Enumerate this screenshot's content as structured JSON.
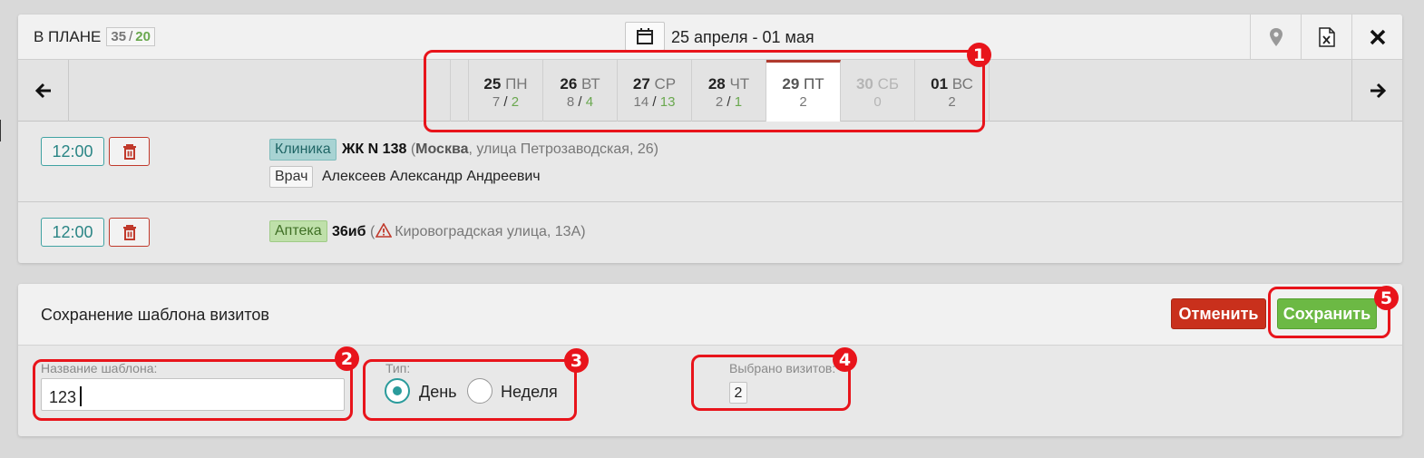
{
  "header": {
    "plan_label": "В ПЛАНЕ",
    "plan_a": "35",
    "plan_sep": "/",
    "plan_b": "20",
    "date_range": "25 апреля - 01 мая",
    "icons": [
      "calendar-icon",
      "map-pin-icon",
      "excel-icon",
      "close-icon"
    ]
  },
  "nav": {
    "prev_icon": "arrow-left-icon",
    "next_icon": "arrow-right-icon"
  },
  "days": [
    {
      "num": "25",
      "wd": "ПН",
      "a": "7",
      "b": "2",
      "state": "normal"
    },
    {
      "num": "26",
      "wd": "ВТ",
      "a": "8",
      "b": "4",
      "state": "normal"
    },
    {
      "num": "27",
      "wd": "СР",
      "a": "14",
      "b": "13",
      "state": "normal"
    },
    {
      "num": "28",
      "wd": "ЧТ",
      "a": "2",
      "b": "1",
      "state": "normal"
    },
    {
      "num": "29",
      "wd": "ПТ",
      "a": "2",
      "b": "",
      "state": "active"
    },
    {
      "num": "30",
      "wd": "СБ",
      "a": "0",
      "b": "",
      "state": "dim"
    },
    {
      "num": "01",
      "wd": "ВС",
      "a": "2",
      "b": "",
      "state": "normal"
    }
  ],
  "visits": [
    {
      "time": "12:00",
      "type": "Клиника",
      "name": "ЖК N 138",
      "addr_open": "(",
      "city": "Москва",
      "address": ", улица Петрозаводская, 26)",
      "role": "Врач",
      "person": "Алексеев Александр Андреевич"
    },
    {
      "time": "12:00",
      "type": "Аптека",
      "name": "36иб",
      "addr_open": "(",
      "address": "Кировоградская улица, 13А)"
    }
  ],
  "template_form": {
    "title": "Сохранение шаблона визитов",
    "cancel_label": "Отменить",
    "save_label": "Сохранить",
    "name_label": "Название шаблона:",
    "name_value": "123",
    "type_label": "Тип:",
    "type_options": [
      "День",
      "Неделя"
    ],
    "type_selected": "День",
    "count_label": "Выбрано визитов:",
    "count_value": "2"
  },
  "markers": [
    "1",
    "2",
    "3",
    "4",
    "5"
  ],
  "colors": {
    "accent_teal": "#2a9b9b",
    "danger": "#c9301c",
    "success": "#6cb944",
    "highlight": "#e8141b"
  }
}
